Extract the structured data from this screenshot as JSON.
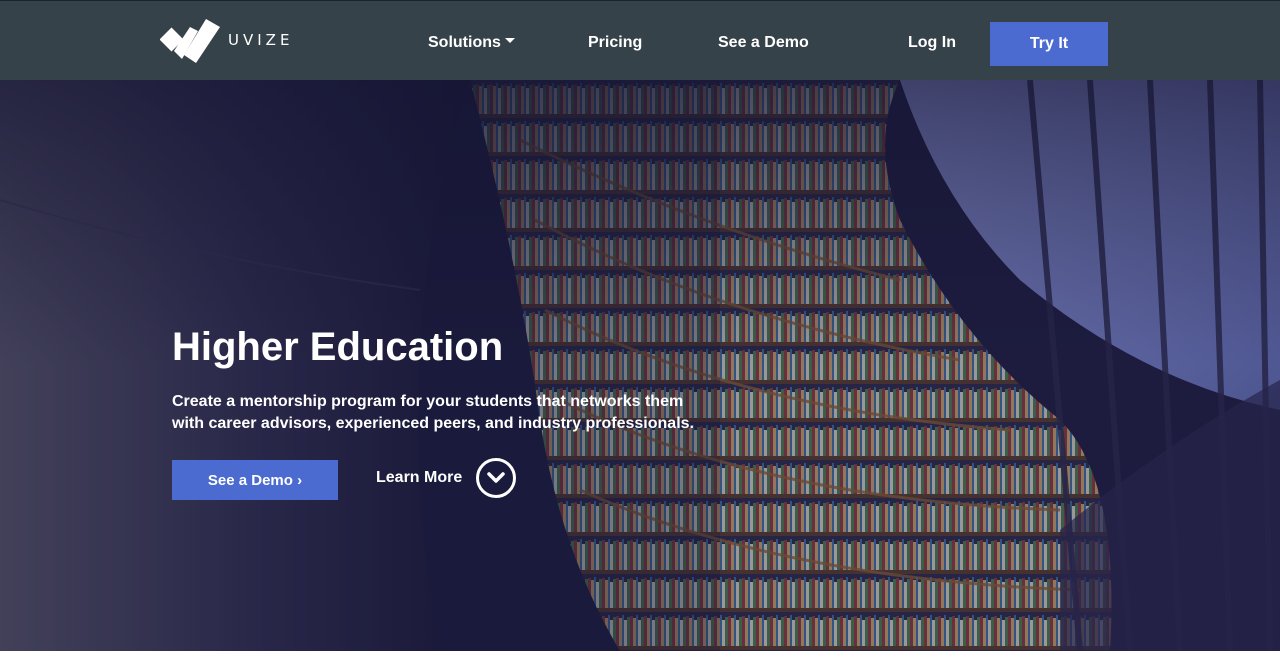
{
  "nav": {
    "logo_text": "UVIZE",
    "items": [
      {
        "label": "Solutions",
        "has_dropdown": true
      },
      {
        "label": "Pricing"
      },
      {
        "label": "See a Demo"
      }
    ],
    "login_label": "Log In",
    "cta_label": "Try It"
  },
  "hero": {
    "title": "Higher Education",
    "subtitle": "Create a mentorship program for your students that networks them with career advisors, experienced peers, and industry professionals.",
    "demo_button": "See a Demo ›",
    "learn_more": "Learn More"
  },
  "colors": {
    "nav_bg": "#36424a",
    "accent": "#4c6bd0",
    "hero_overlay": "#1d1c3f"
  },
  "icons": {
    "logo": "uvize-logo-icon",
    "dropdown": "caret-down-icon",
    "learn_more": "chevron-down-circle-icon"
  }
}
